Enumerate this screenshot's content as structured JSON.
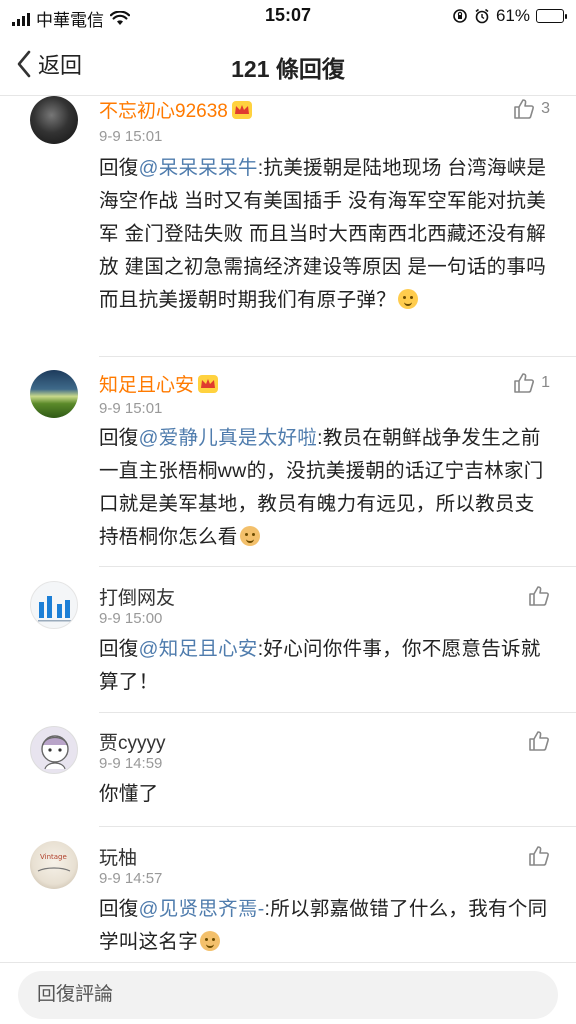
{
  "status_bar": {
    "carrier": "中華電信",
    "time": "15:07",
    "battery": "61%",
    "battery_level": 0.61
  },
  "nav": {
    "back_label": "返回",
    "title": "121 條回復"
  },
  "comments": [
    {
      "user": "不忘初心92638",
      "vip": true,
      "time": "9-9 15:01",
      "likes": "3",
      "reply_prefix": "回復",
      "mention": "@呆呆呆呆牛",
      "text": ":抗美援朝是陆地现场 台湾海峡是海空作战 当时又有美国插手 没有海军空军能对抗美军 金门登陆失败 而且当时大西南西北西藏还没有解放 建国之初急需搞经济建设等原因 是一句话的事吗 而且抗美援朝时期我们有原子弹？",
      "emoji": "smile"
    },
    {
      "user": "知足且心安",
      "vip": true,
      "time": "9-9 15:01",
      "likes": "1",
      "reply_prefix": "回復",
      "mention": "@爱静儿真是太好啦",
      "text": ":教员在朝鲜战争发生之前一直主张梧桐ww的，没抗美援朝的话辽宁吉林家门口就是美军基地，教员有魄力有远见，所以教员支持梧桐你怎么看",
      "emoji": "dog"
    },
    {
      "user": "打倒网友",
      "vip": false,
      "time": "9-9 15:00",
      "likes": "",
      "reply_prefix": "回復",
      "mention": "@知足且心安",
      "text": ":好心问你件事，你不愿意告诉就算了！",
      "emoji": ""
    },
    {
      "user": "贾cyyyy",
      "vip": false,
      "time": "9-9 14:59",
      "likes": "",
      "reply_prefix": "",
      "mention": "",
      "text": "你懂了",
      "emoji": ""
    },
    {
      "user": "玩柚",
      "vip": false,
      "time": "9-9 14:57",
      "likes": "",
      "reply_prefix": "回復",
      "mention": "@见贤思齐焉-",
      "text": ":所以郭嘉做错了什么，我有个同学叫这名字",
      "emoji": "dog"
    }
  ],
  "input": {
    "placeholder": "回復評論"
  },
  "colors": {
    "vip_name": "#ff7a00",
    "mention": "#4f7cad",
    "meta": "#999999"
  },
  "icons": [
    "signal-icon",
    "wifi-icon",
    "lock-rotation-icon",
    "alarm-icon",
    "battery-icon",
    "back-chevron-icon",
    "crown-badge-icon",
    "thumb-up-icon"
  ]
}
